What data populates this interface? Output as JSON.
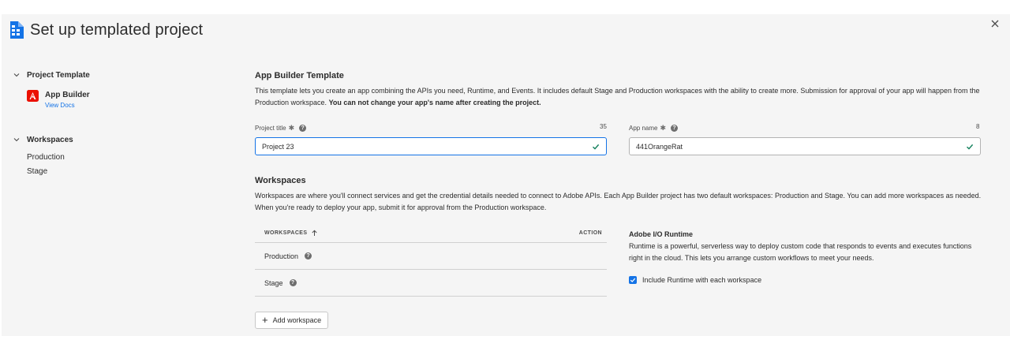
{
  "dialog": {
    "title": "Set up templated project",
    "close_icon": "close-icon"
  },
  "nav": {
    "project_template_header": "Project Template",
    "template_name": "App Builder",
    "view_docs": "View Docs",
    "workspaces_header": "Workspaces",
    "workspace_items": [
      "Production",
      "Stage"
    ]
  },
  "main": {
    "template_heading": "App Builder Template",
    "template_desc": "This template lets you create an app combining the APIs you need, Runtime, and Events. It includes default Stage and Production workspaces with the ability to create more. Submission for approval of your app will happen from the Production workspace.",
    "template_desc_bold": "You can not change your app's name after creating the project.",
    "project_title": {
      "label": "Project title",
      "counter": "35",
      "value": "Project 23"
    },
    "app_name": {
      "label": "App name",
      "counter": "8",
      "value": "441OrangeRat"
    },
    "workspaces_heading": "Workspaces",
    "workspaces_desc": "Workspaces are where you'll connect services and get the credential details needed to connect to Adobe APIs. Each App Builder project has two default workspaces: Production and Stage. You can add more workspaces as needed. When you're ready to deploy your app, submit it for approval from the Production workspace.",
    "table": {
      "col_workspaces": "WORKSPACES",
      "col_action": "ACTION",
      "rows": [
        "Production",
        "Stage"
      ]
    },
    "add_workspace": "Add workspace",
    "runtime_heading": "Adobe I/O Runtime",
    "runtime_desc": "Runtime is a powerful, serverless way to deploy custom code that responds to events and executes functions right in the cloud. This lets you arrange custom workflows to meet your needs.",
    "include_runtime": "Include Runtime with each workspace",
    "include_runtime_checked": true
  },
  "colors": {
    "accent": "#1473e6",
    "adobe_red": "#eb1000",
    "valid_green": "#12805c",
    "panel_bg": "#f5f5f5"
  }
}
